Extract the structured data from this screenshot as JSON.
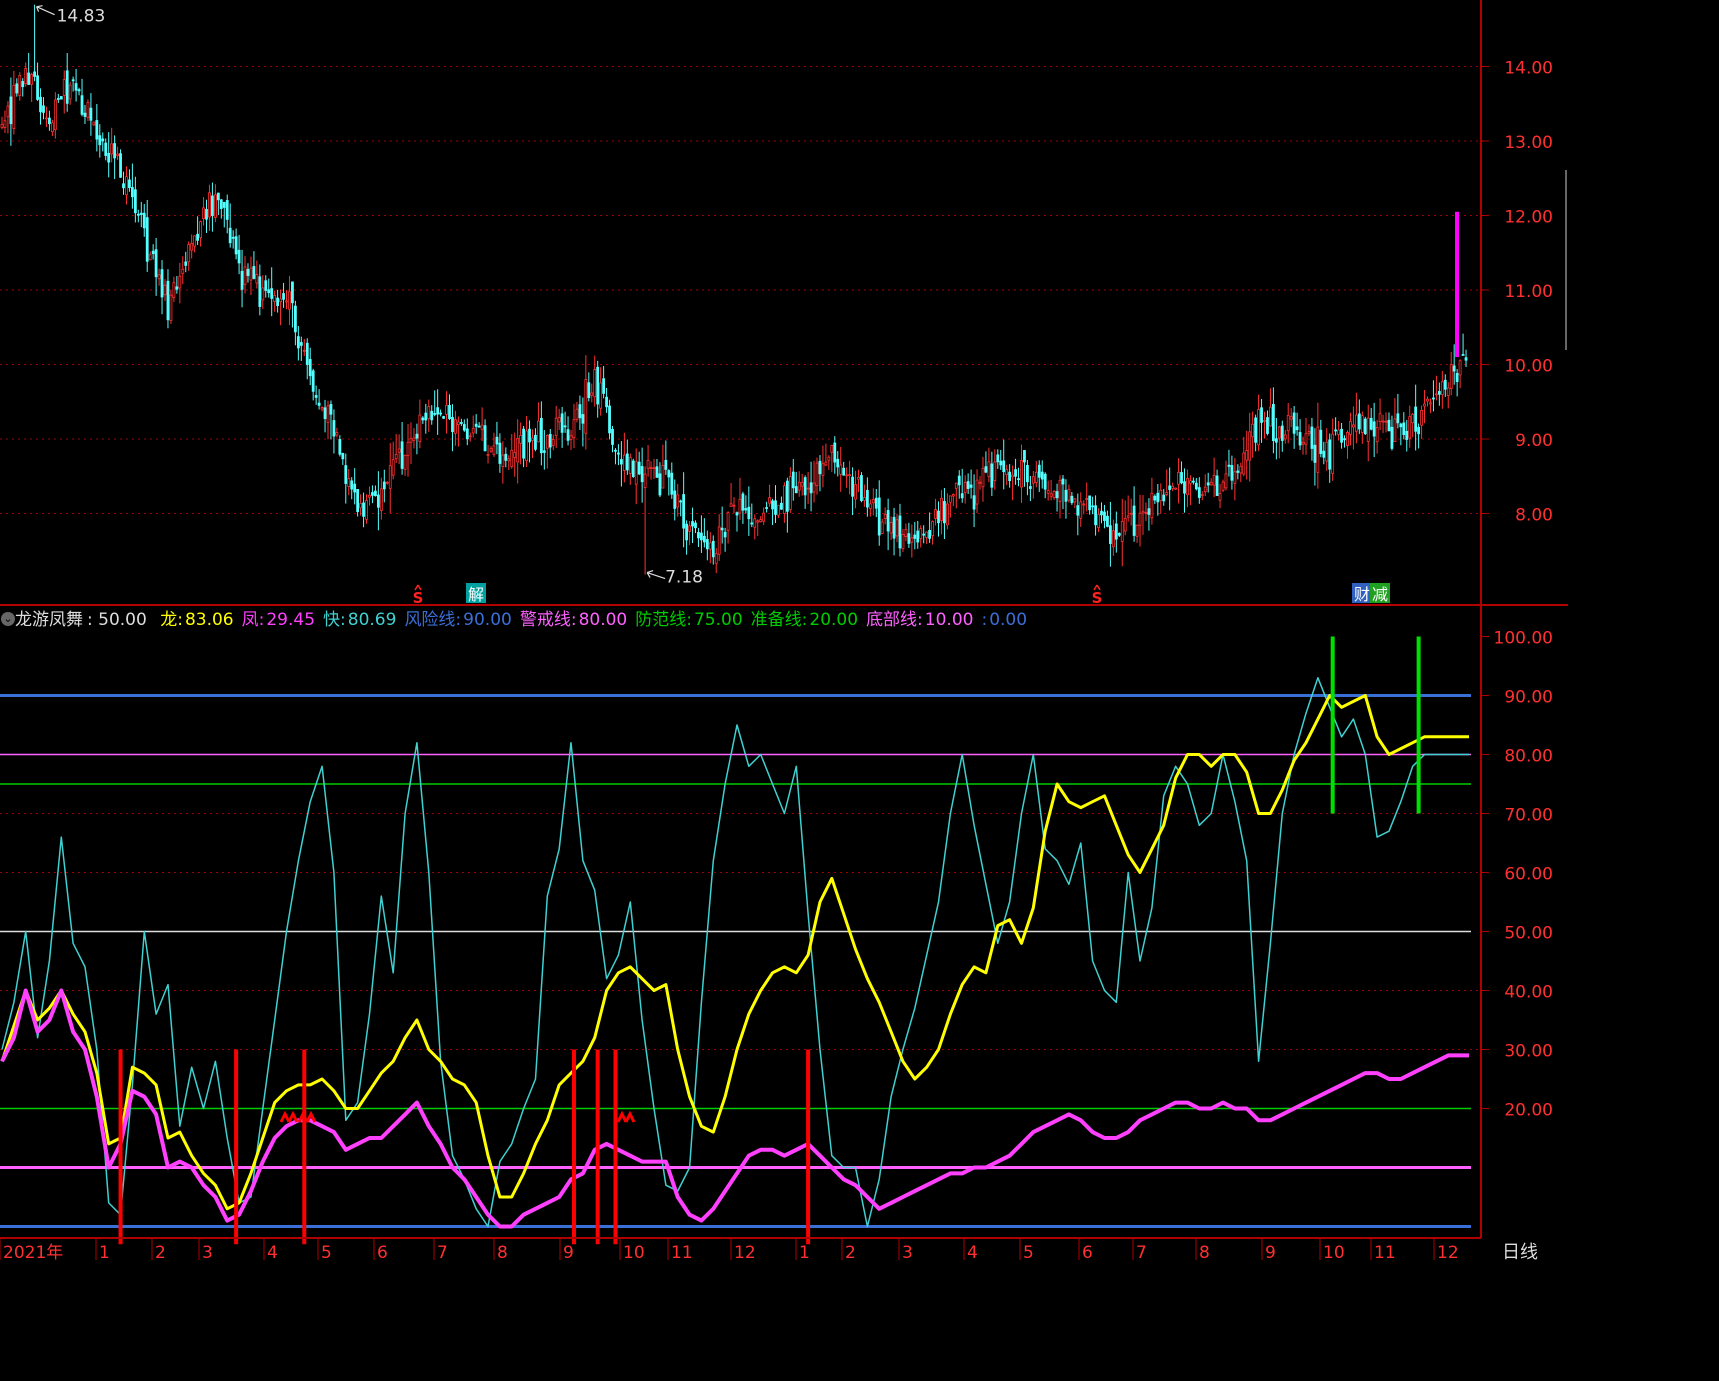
{
  "colors": {
    "background": "#000000",
    "frame": "#b00000",
    "axis_text": "#ff3030",
    "grid_dotted": "#a00000",
    "candle_up": "#ff3030",
    "candle_down": "#54ffff",
    "long": "#ffff00",
    "feng": "#ff40ff",
    "kuai": "#40d0d0",
    "risk_line": "#3b6fd8",
    "warning_line": "#ff60ff",
    "guard_line": "#00cc00",
    "mid_line": "#dddddd",
    "prep_line": "#00cc00",
    "bottom_line": "#ff60ff",
    "zero_line": "#3b6fd8",
    "buy_signal": "#ff0000",
    "sell_signal": "#00e000",
    "today_bar": "#ff00ff"
  },
  "price_panel": {
    "high_marker": "14.83",
    "low_marker": "7.18",
    "y_ticks": [
      "14.00",
      "13.00",
      "12.00",
      "11.00",
      "10.00",
      "9.00",
      "8.00"
    ],
    "events": [
      {
        "label": "S",
        "icon": "s-event-icon",
        "color": "#ff2020"
      },
      {
        "label": "解",
        "icon": "unlock-event-badge",
        "color": "#00a0a0"
      },
      {
        "label": "S",
        "icon": "s-event-icon",
        "color": "#ff2020"
      },
      {
        "label": "财",
        "icon": "finance-event-badge",
        "color": "#3060c0"
      },
      {
        "label": "减",
        "icon": "reduce-event-badge",
        "color": "#20a020"
      }
    ]
  },
  "indicator_panel": {
    "name": "龙游凤舞",
    "name_value": ": 50.00",
    "items": [
      {
        "label": "龙:",
        "value": "83.06",
        "color": "#ffff00"
      },
      {
        "label": "凤:",
        "value": "29.45",
        "color": "#ff40ff"
      },
      {
        "label": "快:",
        "value": "80.69",
        "color": "#40d0d0"
      },
      {
        "label": "风险线:",
        "value": "90.00",
        "color": "#3b6fd8"
      },
      {
        "label": "警戒线:",
        "value": "80.00",
        "color": "#ff60ff"
      },
      {
        "label": "防范线:",
        "value": "75.00",
        "color": "#00cc00"
      },
      {
        "label": "准备线:",
        "value": "20.00",
        "color": "#00cc00"
      },
      {
        "label": "底部线:",
        "value": "10.00",
        "color": "#ff60ff"
      },
      {
        "label": ":",
        "value": "0.00",
        "color": "#3b6fd8"
      }
    ],
    "y_ticks": [
      "100.00",
      "90.00",
      "80.00",
      "70.00",
      "60.00",
      "50.00",
      "40.00",
      "30.00",
      "20.00"
    ]
  },
  "x_axis": {
    "labels": [
      "2021年",
      "1",
      "2",
      "3",
      "4",
      "5",
      "6",
      "7",
      "8",
      "9",
      "10",
      "11",
      "12",
      "1",
      "2",
      "3",
      "4",
      "5",
      "6",
      "7",
      "8",
      "9",
      "10",
      "11",
      "12"
    ],
    "period": "日线"
  },
  "chart_data": [
    {
      "type": "candlestick",
      "title": "",
      "x_range": [
        "2021年",
        "12"
      ],
      "ylim": [
        7.0,
        14.85
      ],
      "grid": "dotted horizontal",
      "highest": 14.83,
      "lowest": 7.18,
      "close_path": {
        "index": [
          0,
          8,
          16,
          24,
          32,
          40,
          48,
          56,
          64,
          72,
          80,
          88,
          96,
          104,
          112,
          120,
          128,
          136,
          144,
          152,
          160,
          168,
          176,
          184,
          192,
          200,
          208,
          216,
          224,
          232,
          240,
          248,
          256,
          264,
          272,
          280,
          288,
          296,
          304,
          312,
          320,
          328,
          336,
          344,
          352,
          360,
          368,
          376,
          384,
          392,
          400,
          408,
          416,
          424,
          432,
          440,
          448,
          456,
          464,
          472,
          480,
          488,
          495
        ],
        "values": [
          13.2,
          14.0,
          13.2,
          13.9,
          13.1,
          12.6,
          11.8,
          10.8,
          11.7,
          12.3,
          11.3,
          10.9,
          10.9,
          9.8,
          9.1,
          8.0,
          8.3,
          8.9,
          9.3,
          9.2,
          9.1,
          8.7,
          8.9,
          9.0,
          9.1,
          9.8,
          8.8,
          8.6,
          8.4,
          7.8,
          7.5,
          8.1,
          7.9,
          8.2,
          8.5,
          8.7,
          8.3,
          8.0,
          7.7,
          7.8,
          8.2,
          8.3,
          8.6,
          8.5,
          8.4,
          8.2,
          8.0,
          7.7,
          8.0,
          8.2,
          8.4,
          8.3,
          8.5,
          9.2,
          9.1,
          9.0,
          8.8,
          9.3,
          9.2,
          9.0,
          9.4,
          9.8,
          10.0
        ]
      },
      "last_bar": {
        "low": 10.1,
        "high": 12.05
      }
    },
    {
      "type": "line",
      "title": "龙游凤舞",
      "ylim": [
        -3,
        104
      ],
      "x": [
        0,
        4,
        8,
        12,
        16,
        20,
        24,
        28,
        32,
        36,
        40,
        44,
        48,
        52,
        56,
        60,
        64,
        68,
        72,
        76,
        80,
        84,
        88,
        92,
        96,
        100,
        104,
        108,
        112,
        116,
        120,
        124,
        128,
        132,
        136,
        140,
        144,
        148,
        152,
        156,
        160,
        164,
        168,
        172,
        176,
        180,
        184,
        188,
        192,
        196,
        200,
        204,
        208,
        212,
        216,
        220,
        224,
        228,
        232,
        236,
        240,
        244,
        248,
        252,
        256,
        260,
        264,
        268,
        272,
        276,
        280,
        284,
        288,
        292,
        296,
        300,
        304,
        308,
        312,
        316,
        320,
        324,
        328,
        332,
        336,
        340,
        344,
        348,
        352,
        356,
        360,
        364,
        368,
        372,
        376,
        380,
        384,
        388,
        392,
        396,
        400,
        404,
        408,
        412,
        416,
        420,
        424,
        428,
        432,
        436,
        440,
        444,
        448,
        452,
        456,
        460,
        464,
        468,
        472,
        476,
        480,
        484,
        488,
        492,
        495
      ],
      "series": [
        {
          "name": "龙",
          "color": "#ffff00",
          "values": [
            28,
            34,
            40,
            35,
            37,
            40,
            36,
            33,
            26,
            14,
            15,
            27,
            26,
            24,
            15,
            16,
            12,
            9,
            7,
            3,
            4,
            9,
            15,
            21,
            23,
            24,
            24,
            25,
            23,
            20,
            20,
            23,
            26,
            28,
            32,
            35,
            30,
            28,
            25,
            24,
            21,
            12,
            5,
            5,
            9,
            14,
            18,
            24,
            26,
            28,
            32,
            40,
            43,
            44,
            42,
            40,
            41,
            30,
            22,
            17,
            16,
            22,
            30,
            36,
            40,
            43,
            44,
            43,
            46,
            55,
            59,
            53,
            47,
            42,
            38,
            33,
            28,
            25,
            27,
            30,
            36,
            41,
            44,
            43,
            51,
            52,
            48,
            54,
            67,
            75,
            72,
            71,
            72,
            73,
            68,
            63,
            60,
            64,
            68,
            76,
            80,
            80,
            78,
            80,
            80,
            77,
            70,
            70,
            74,
            79,
            82,
            86,
            90,
            88,
            89,
            90,
            83,
            80,
            81,
            82,
            83,
            83,
            83,
            83,
            83
          ]
        },
        {
          "name": "凤",
          "color": "#ff40ff",
          "values": [
            28,
            32,
            40,
            33,
            35,
            40,
            33,
            30,
            22,
            10,
            14,
            23,
            22,
            19,
            10,
            11,
            10,
            7,
            5,
            1,
            2,
            6,
            11,
            15,
            17,
            18,
            18,
            17,
            16,
            13,
            14,
            15,
            15,
            17,
            19,
            21,
            17,
            14,
            10,
            8,
            5,
            2,
            0,
            0,
            2,
            3,
            4,
            5,
            8,
            9,
            13,
            14,
            13,
            12,
            11,
            11,
            11,
            5,
            2,
            1,
            3,
            6,
            9,
            12,
            13,
            13,
            12,
            13,
            14,
            12,
            10,
            8,
            7,
            5,
            3,
            4,
            5,
            6,
            7,
            8,
            9,
            9,
            10,
            10,
            11,
            12,
            14,
            16,
            17,
            18,
            19,
            18,
            16,
            15,
            15,
            16,
            18,
            19,
            20,
            21,
            21,
            20,
            20,
            21,
            20,
            20,
            18,
            18,
            19,
            20,
            21,
            22,
            23,
            24,
            25,
            26,
            26,
            25,
            25,
            26,
            27,
            28,
            29,
            29,
            29
          ]
        },
        {
          "name": "快",
          "color": "#40d0d0",
          "values": [
            30,
            38,
            50,
            32,
            45,
            66,
            48,
            44,
            30,
            4,
            2,
            24,
            50,
            36,
            41,
            17,
            27,
            20,
            28,
            15,
            4,
            5,
            20,
            35,
            50,
            62,
            72,
            78,
            60,
            18,
            21,
            36,
            56,
            43,
            70,
            82,
            60,
            28,
            12,
            8,
            3,
            0,
            11,
            14,
            20,
            25,
            56,
            64,
            82,
            62,
            57,
            42,
            46,
            55,
            35,
            20,
            7,
            6,
            10,
            38,
            62,
            75,
            85,
            78,
            80,
            75,
            70,
            78,
            53,
            30,
            12,
            10,
            10,
            0,
            8,
            22,
            30,
            37,
            46,
            55,
            70,
            80,
            68,
            58,
            48,
            55,
            70,
            80,
            64,
            62,
            58,
            65,
            45,
            40,
            38,
            60,
            45,
            54,
            73,
            78,
            75,
            68,
            70,
            80,
            72,
            62,
            28,
            48,
            70,
            80,
            87,
            93,
            88,
            83,
            86,
            80,
            66,
            67,
            72,
            78,
            80,
            80,
            80,
            80,
            80
          ]
        }
      ],
      "reference_lines": [
        {
          "name": "风险线",
          "value": 90
        },
        {
          "name": "警戒线",
          "value": 80
        },
        {
          "name": "防范线",
          "value": 75
        },
        {
          "name": "龙游凤舞",
          "value": 50
        },
        {
          "name": "准备线",
          "value": 20
        },
        {
          "name": "底部线",
          "value": 10
        },
        {
          "name": "",
          "value": 0
        }
      ],
      "buy_signals_x": [
        40,
        79,
        102,
        193,
        201,
        207,
        272
      ],
      "sell_signals_x": [
        449,
        478
      ]
    }
  ]
}
